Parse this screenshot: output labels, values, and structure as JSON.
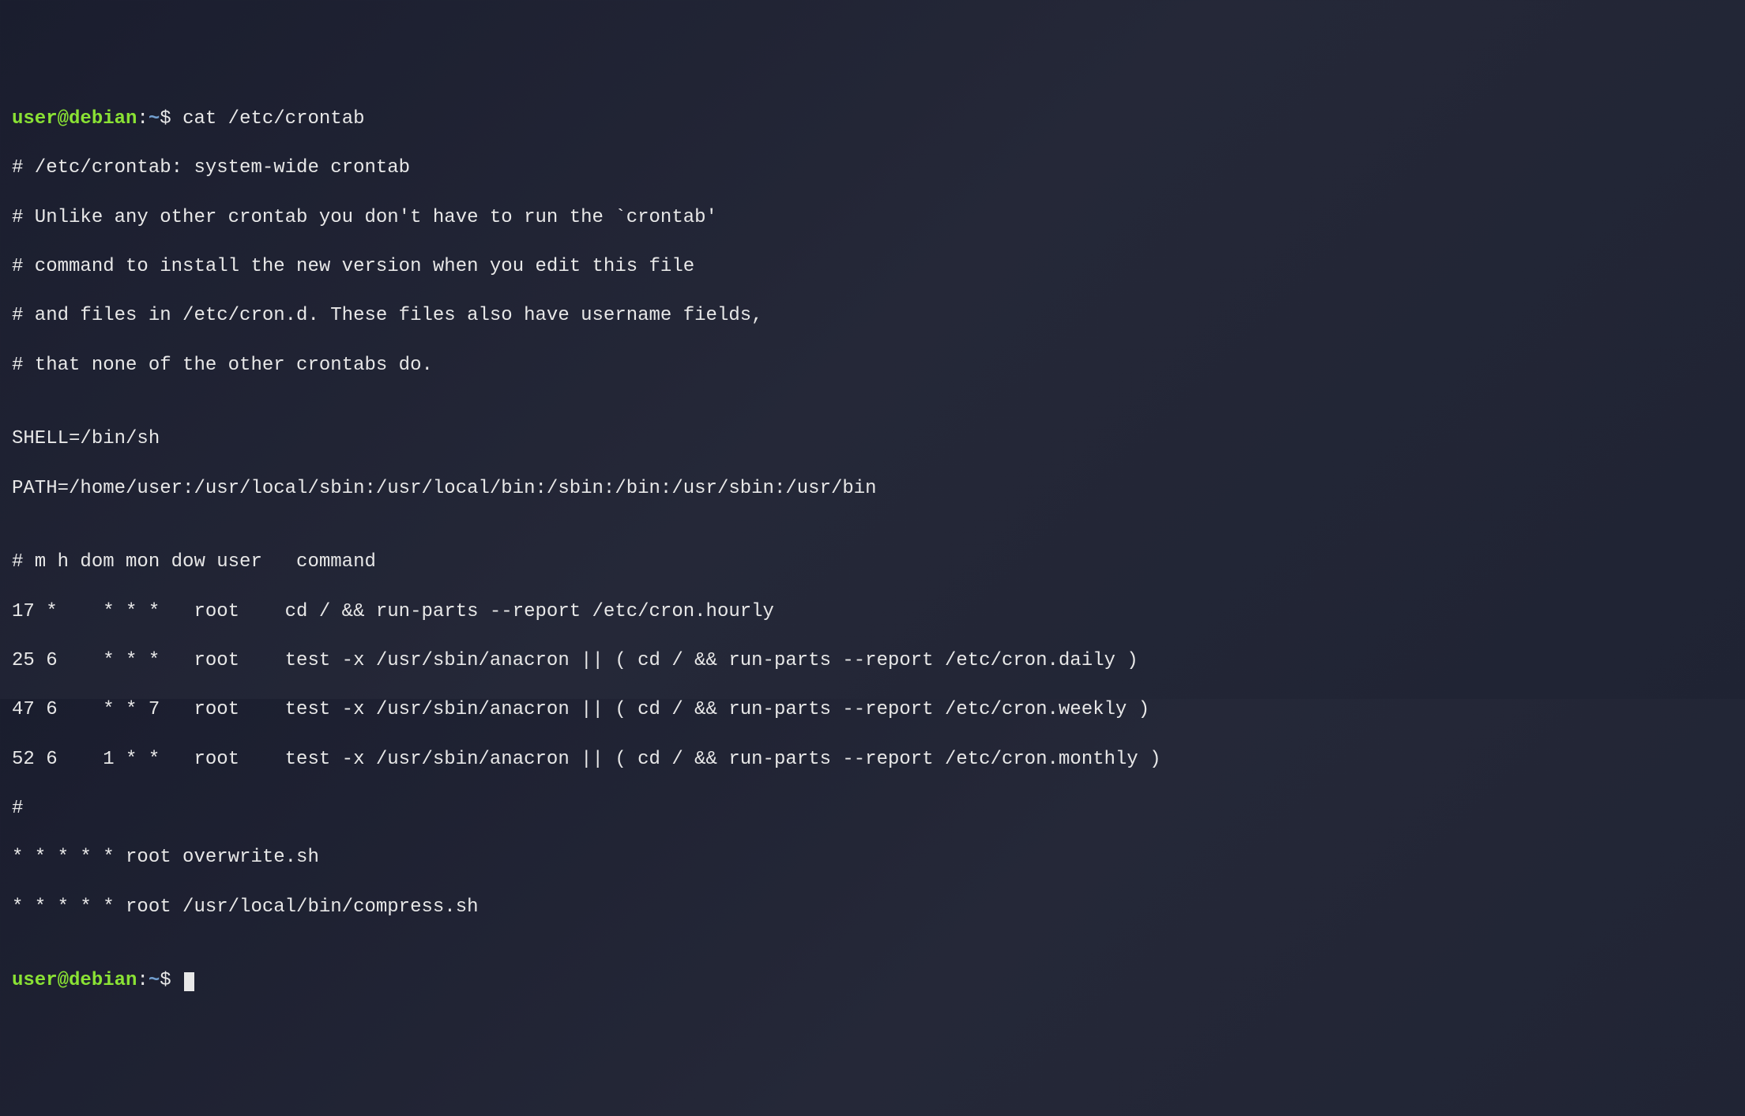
{
  "prompt1": {
    "user": "user",
    "at": "@",
    "host": "debian",
    "colon": ":",
    "path": "~",
    "dollar": "$ ",
    "command": "cat /etc/crontab"
  },
  "output": {
    "l1": "# /etc/crontab: system-wide crontab",
    "l2": "# Unlike any other crontab you don't have to run the `crontab'",
    "l3": "# command to install the new version when you edit this file",
    "l4": "# and files in /etc/cron.d. These files also have username fields,",
    "l5": "# that none of the other crontabs do.",
    "l6": "",
    "l7": "SHELL=/bin/sh",
    "l8": "PATH=/home/user:/usr/local/sbin:/usr/local/bin:/sbin:/bin:/usr/sbin:/usr/bin",
    "l9": "",
    "l10": "# m h dom mon dow user   command",
    "l11": "17 *    * * *   root    cd / && run-parts --report /etc/cron.hourly",
    "l12": "25 6    * * *   root    test -x /usr/sbin/anacron || ( cd / && run-parts --report /etc/cron.daily )",
    "l13": "47 6    * * 7   root    test -x /usr/sbin/anacron || ( cd / && run-parts --report /etc/cron.weekly )",
    "l14": "52 6    1 * *   root    test -x /usr/sbin/anacron || ( cd / && run-parts --report /etc/cron.monthly )",
    "l15": "#",
    "l16": "* * * * * root overwrite.sh",
    "l17": "* * * * * root /usr/local/bin/compress.sh",
    "l18": ""
  },
  "prompt2": {
    "user": "user",
    "at": "@",
    "host": "debian",
    "colon": ":",
    "path": "~",
    "dollar": "$ "
  }
}
